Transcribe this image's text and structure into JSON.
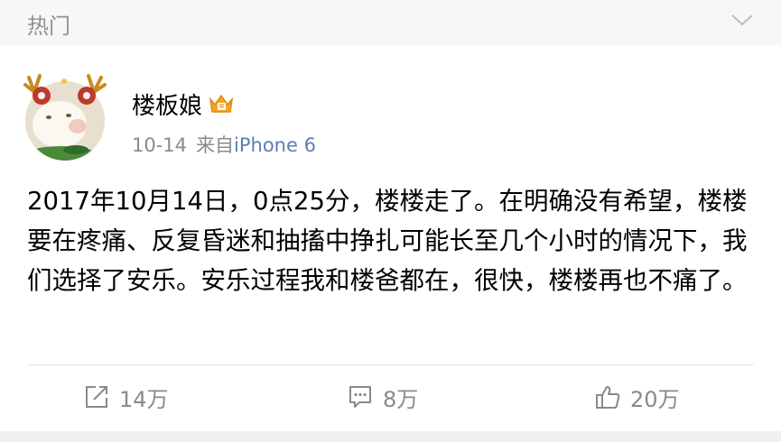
{
  "section": {
    "title": "热门",
    "toggle_icon": "chevron-down-icon"
  },
  "post": {
    "author": {
      "name": "楼板娘",
      "badge_icon": "vip-crown-icon",
      "avatar": "cat-with-antlers-avatar"
    },
    "meta": {
      "date": "10-14",
      "source_prefix": "来自",
      "source_device": "iPhone 6"
    },
    "text": "2017年10月14日，0点25分，楼楼走了。在明确没有希望，楼楼要在疼痛、反复昏迷和抽搐中挣扎可能长至几个小时的情况下，我们选择了安乐。安乐过程我和楼爸都在，很快，楼楼再也不痛了。",
    "actions": {
      "repost": {
        "icon": "repost-icon",
        "count": "14万"
      },
      "comment": {
        "icon": "comment-icon",
        "count": "8万"
      },
      "like": {
        "icon": "thumbs-up-icon",
        "count": "20万"
      }
    }
  },
  "colors": {
    "link": "#5b7fb2",
    "muted": "#8a8a8a",
    "header_bg": "#f7f7f7",
    "badge": "#f5a623"
  }
}
